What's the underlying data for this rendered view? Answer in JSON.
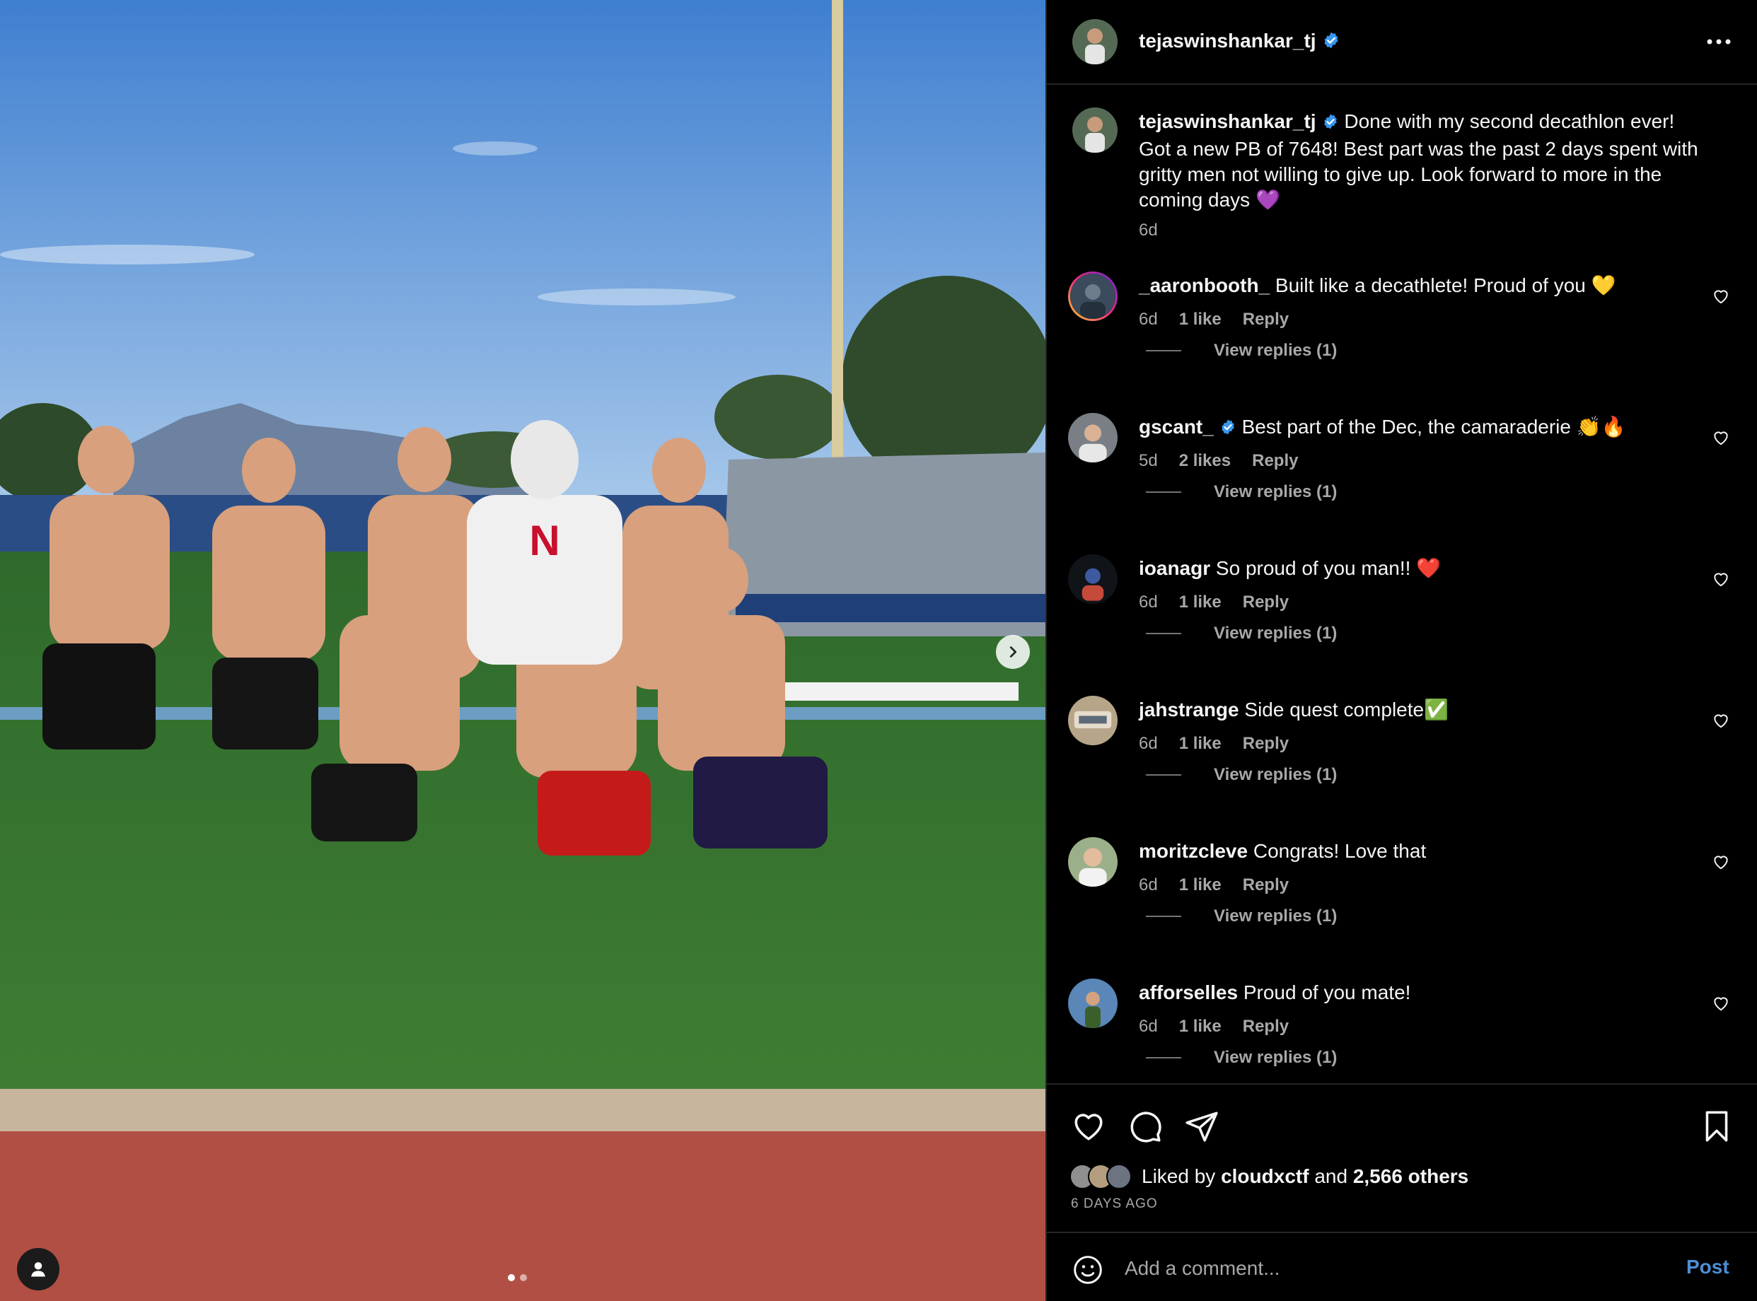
{
  "post": {
    "author": "tejaswinshankar_tj",
    "author_verified": true,
    "caption_text": "Done with my second decathlon ever! Got a new PB of 7648! Best part was the past 2 days spent with gritty men not willing to give up. Look forward to more in the coming days 💜",
    "caption_time": "6d",
    "more_icon": "more-horizontal-icon"
  },
  "comments": [
    {
      "user": "_aaronbooth_",
      "verified": false,
      "text": "Built like a decathlete! Proud of you 💛",
      "time": "6d",
      "likes": "1 like",
      "reply": "Reply",
      "view_replies": "View replies (1)",
      "avatar_color": "#3b4a5c",
      "story_ring": true
    },
    {
      "user": "gscant_",
      "verified": true,
      "text": "Best part of the Dec, the camaraderie 👏🔥",
      "time": "5d",
      "likes": "2 likes",
      "reply": "Reply",
      "view_replies": "View replies (1)",
      "avatar_color": "#7a7f86",
      "story_ring": false
    },
    {
      "user": "ioanagr",
      "verified": false,
      "text": "So proud of you man!! ❤️",
      "time": "6d",
      "likes": "1 like",
      "reply": "Reply",
      "view_replies": "View replies (1)",
      "avatar_color": "#2b3a6b",
      "story_ring": false
    },
    {
      "user": "jahstrange",
      "verified": false,
      "text": "Side quest complete✅",
      "time": "6d",
      "likes": "1 like",
      "reply": "Reply",
      "view_replies": "View replies (1)",
      "avatar_color": "#b7a58a",
      "story_ring": false
    },
    {
      "user": "moritzcleve",
      "verified": false,
      "text": "Congrats! Love that",
      "time": "6d",
      "likes": "1 like",
      "reply": "Reply",
      "view_replies": "View replies (1)",
      "avatar_color": "#c9b08f",
      "story_ring": false
    },
    {
      "user": "afforselles",
      "verified": false,
      "text": "Proud of you mate!",
      "time": "6d",
      "likes": "1 like",
      "reply": "Reply",
      "view_replies": "View replies (1)",
      "avatar_color": "#5a86b8",
      "story_ring": false
    }
  ],
  "footer": {
    "liked_by_prefix": "Liked by",
    "liked_by_user": "cloudxctf",
    "liked_by_and": "and",
    "liked_by_others": "2,566 others",
    "time_ago": "6 DAYS AGO",
    "comment_placeholder": "Add a comment...",
    "post_button": "Post"
  },
  "carousel": {
    "slides": 2,
    "active": 1
  },
  "colors": {
    "background": "#000000",
    "text": "#f5f5f5",
    "secondary": "#a8a8a8",
    "link": "#4c8fd6",
    "verified": "#3797f0"
  }
}
